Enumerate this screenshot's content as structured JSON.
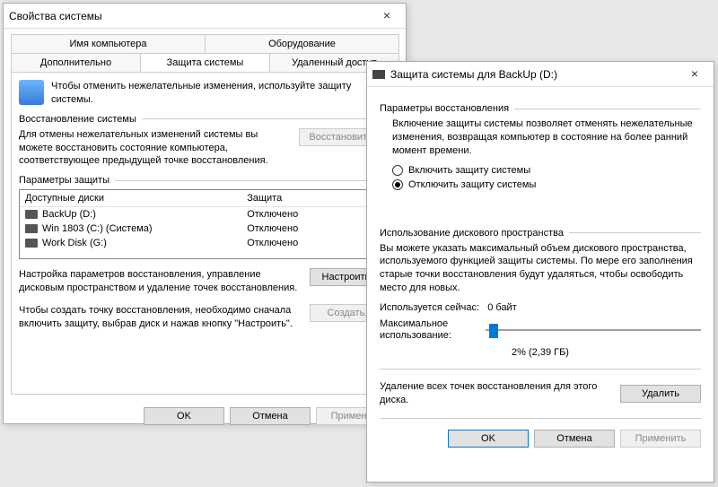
{
  "win1": {
    "title": "Свойства системы",
    "tabs_row1": [
      "Имя компьютера",
      "Оборудование"
    ],
    "tabs_row2": [
      "Дополнительно",
      "Защита системы",
      "Удаленный доступ"
    ],
    "active_tab": "Защита системы",
    "info_text": "Чтобы отменить нежелательные изменения, используйте защиту системы.",
    "restore_group": "Восстановление системы",
    "restore_text": "Для отмены нежелательных изменений системы вы можете восстановить состояние компьютера, соответствующее предыдущей точке восстановления.",
    "restore_btn": "Восстановить...",
    "settings_group": "Параметры защиты",
    "table": {
      "col1": "Доступные диски",
      "col2": "Защита",
      "rows": [
        {
          "name": "BackUp (D:)",
          "status": "Отключено"
        },
        {
          "name": "Win 1803 (C:) (Система)",
          "status": "Отключено"
        },
        {
          "name": "Work Disk (G:)",
          "status": "Отключено"
        }
      ]
    },
    "config_text": "Настройка параметров восстановления, управление дисковым пространством и удаление точек восстановления.",
    "config_btn": "Настроить...",
    "create_text": "Чтобы создать точку восстановления, необходимо сначала включить защиту, выбрав диск и нажав кнопку \"Настроить\".",
    "create_btn": "Создать...",
    "ok": "OK",
    "cancel": "Отмена",
    "apply": "Применить"
  },
  "win2": {
    "title": "Защита системы для BackUp (D:)",
    "params_group": "Параметры восстановления",
    "params_text": "Включение защиты системы позволяет отменять нежелательные изменения, возвращая компьютер в состояние на более ранний момент времени.",
    "radio_on": "Включить защиту системы",
    "radio_off": "Отключить защиту системы",
    "selected_radio": "off",
    "disk_group": "Использование дискового пространства",
    "disk_text": "Вы можете указать максимальный объем дискового пространства, используемого функцией защиты системы. По мере его заполнения старые точки восстановления будут удаляться, чтобы освободить место для новых.",
    "used_label": "Используется сейчас:",
    "used_value": "0 байт",
    "max_label": "Максимальное использование:",
    "slider_value": "2% (2,39 ГБ)",
    "delete_text": "Удаление всех точек восстановления для этого диска.",
    "delete_btn": "Удалить",
    "ok": "OK",
    "cancel": "Отмена",
    "apply": "Применить"
  }
}
